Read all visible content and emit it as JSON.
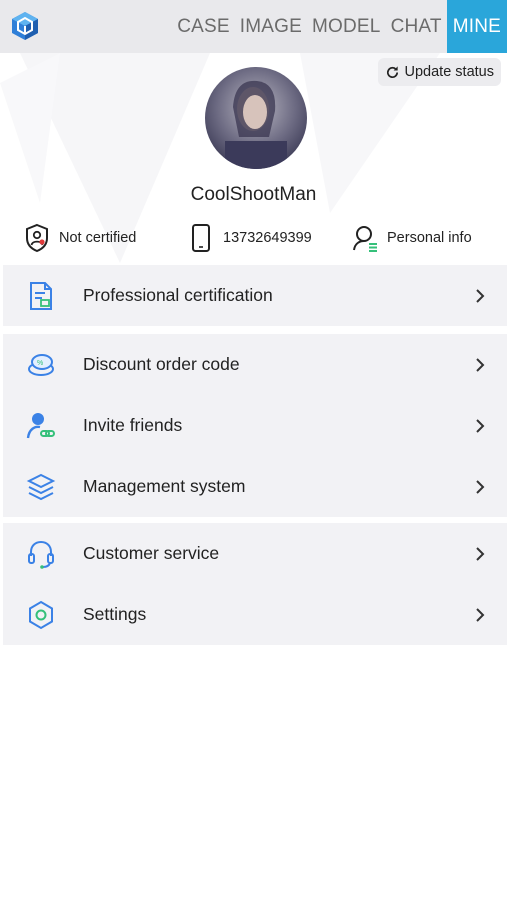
{
  "nav": {
    "tabs": [
      "CASE",
      "IMAGE",
      "MODEL",
      "CHAT",
      "MINE"
    ],
    "active_tab": "MINE"
  },
  "profile": {
    "update_status_label": "Update status",
    "username": "CoolShootMan",
    "certification_status": "Not certified",
    "phone": "13732649399",
    "personal_info_label": "Personal info"
  },
  "menu": {
    "professional_certification": "Professional certification",
    "discount_order_code": "Discount order code",
    "invite_friends": "Invite friends",
    "management_system": "Management system",
    "customer_service": "Customer service",
    "settings": "Settings"
  },
  "colors": {
    "accent": "#2aa6da",
    "icon_blue": "#3b82e6",
    "icon_green": "#35c07a",
    "topbar_bg": "#e9e9ec",
    "menu_bg": "#f2f2f5"
  }
}
